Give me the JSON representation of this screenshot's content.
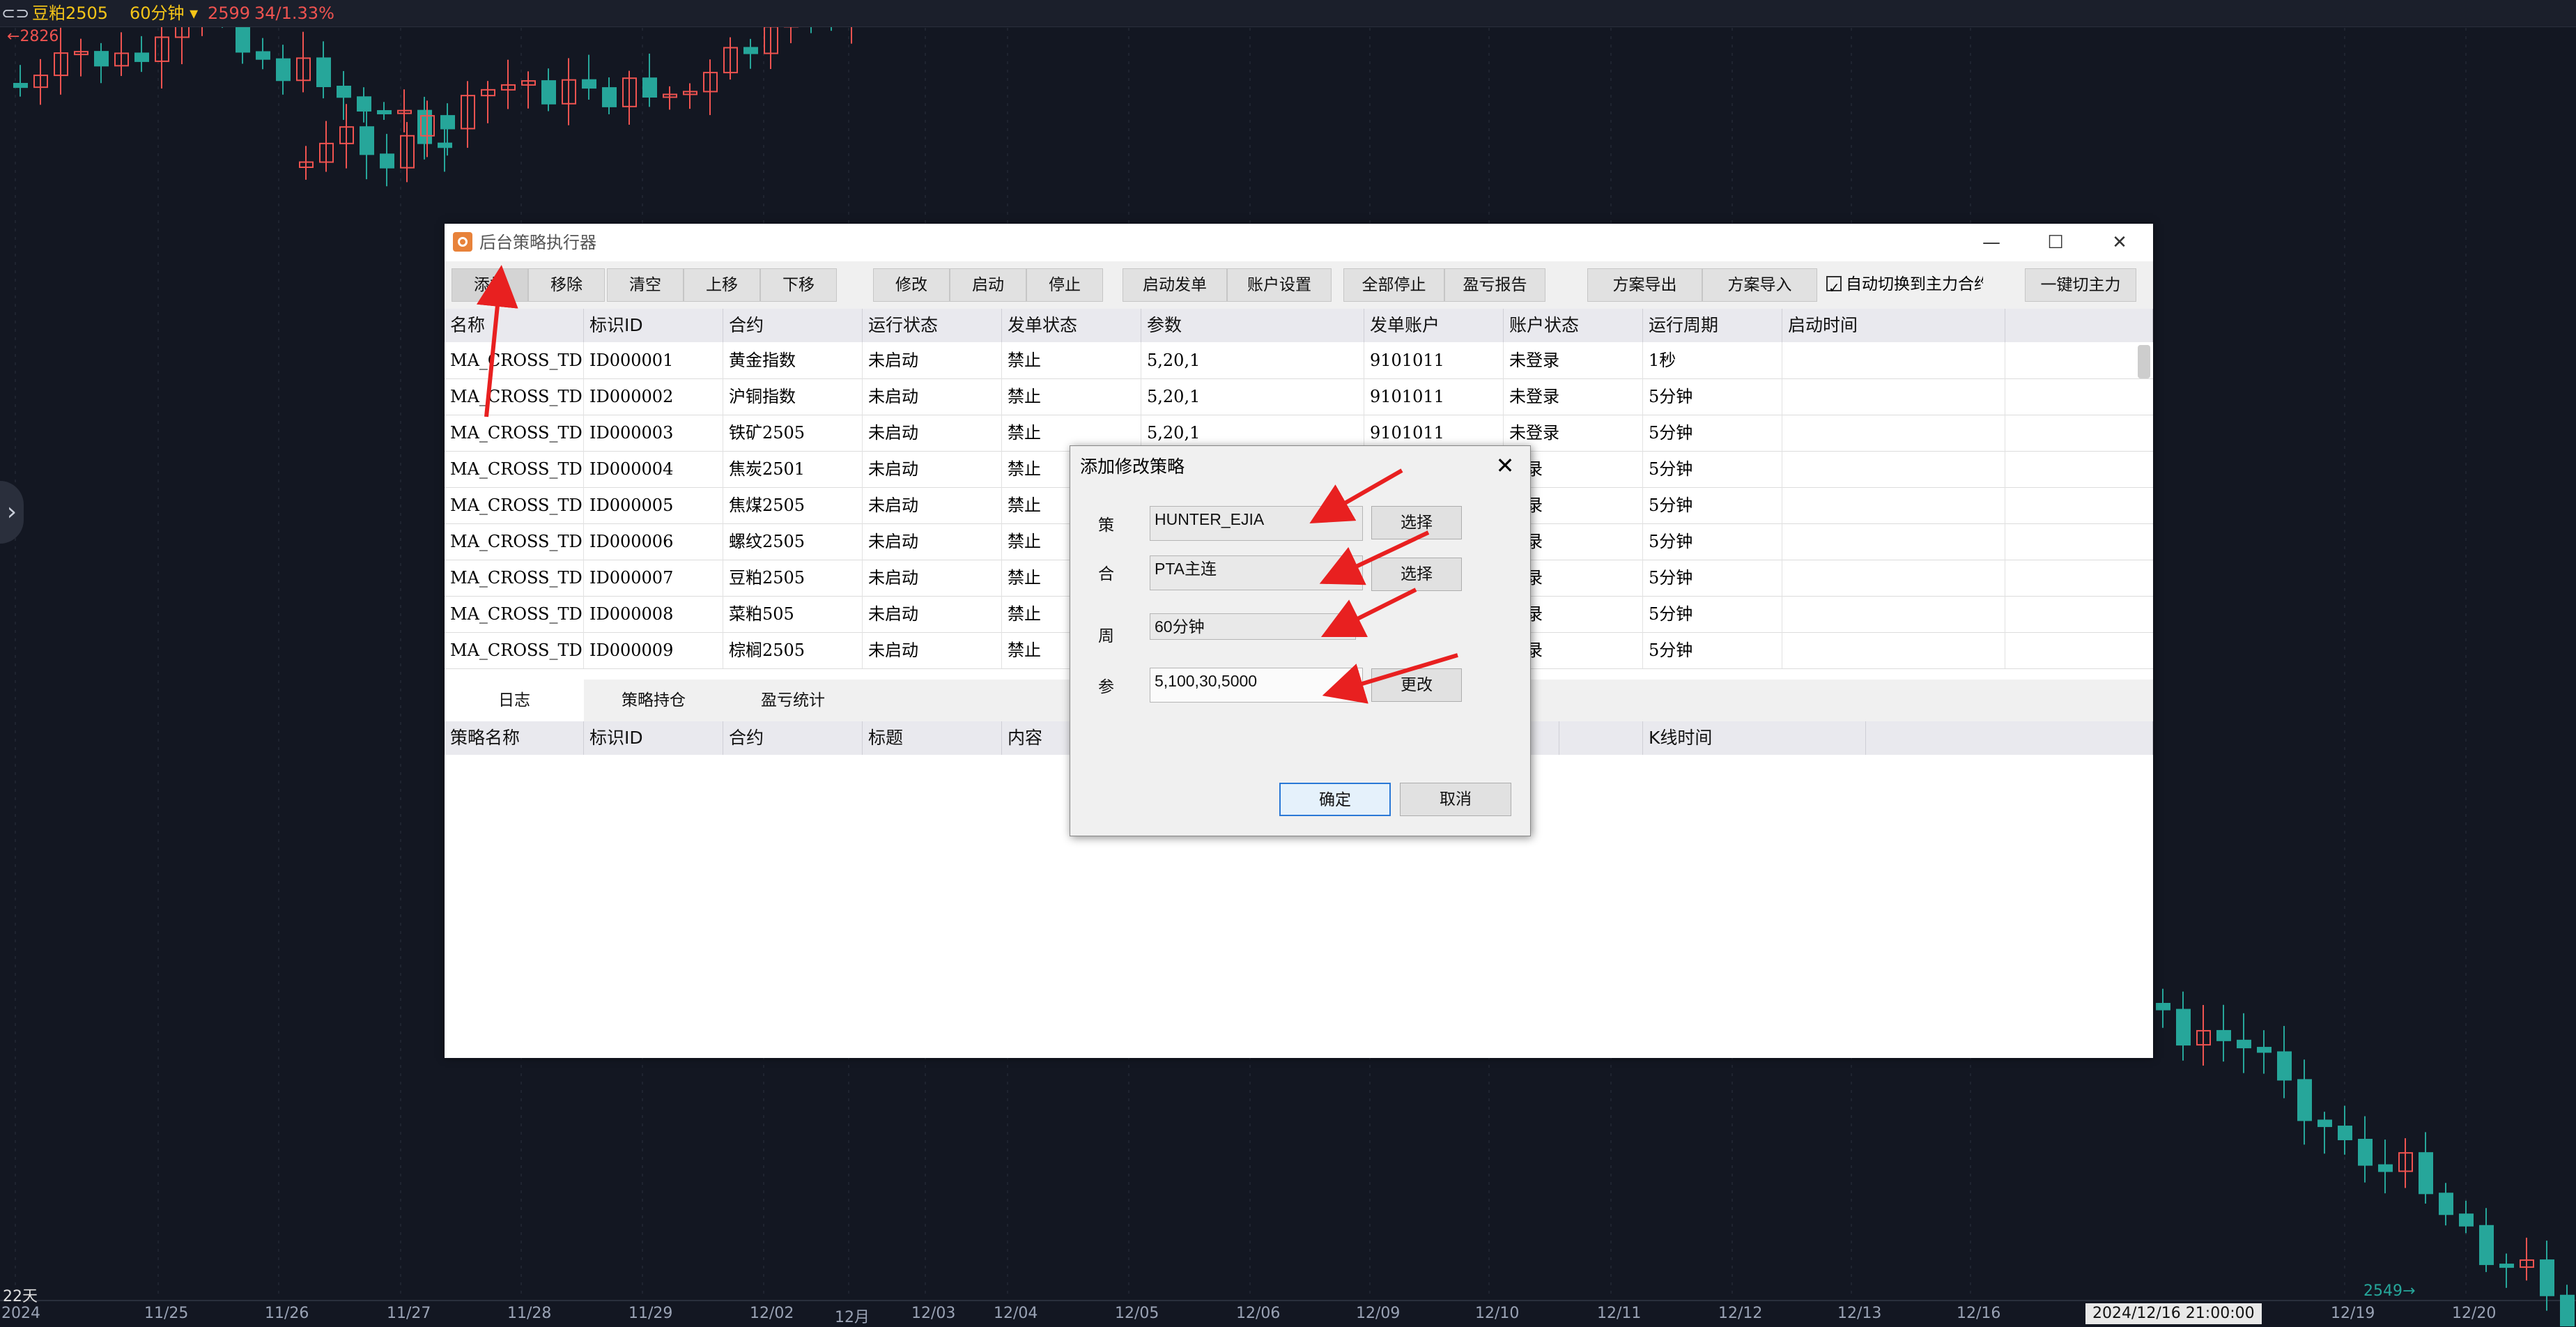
{
  "header": {
    "symbol": "豆粕2505",
    "period": "60分钟",
    "price": "2599",
    "change": "34/1.33%"
  },
  "chart": {
    "high_price_label": "2826",
    "low_price_label": "2549",
    "bar_count_label": "22天",
    "crosshair_time": "2024/12/16 21:00:00",
    "x_axis_labels": [
      "2024",
      "11/25",
      "11/26",
      "11/27",
      "11/28",
      "11/29",
      "12/02",
      "12月",
      "12/03",
      "12/04",
      "12/05",
      "12/06",
      "12/09",
      "12/10",
      "12/11",
      "12/12",
      "12/13",
      "12/16",
      "12/19",
      "12/20"
    ],
    "colors": {
      "up": "#ef5350",
      "down": "#26a69a",
      "background": "#131722"
    }
  },
  "window": {
    "title": "后台策略执行器",
    "controls": [
      "—",
      "☐",
      "✕"
    ]
  },
  "toolbar": {
    "add": "添加",
    "remove": "移除",
    "clear": "清空",
    "move_up": "上移",
    "move_down": "下移",
    "modify": "修改",
    "start": "启动",
    "stop": "停止",
    "start_order": "启动发单",
    "account_settings": "账户设置",
    "stop_all": "全部停止",
    "pnl_report": "盈亏报告",
    "export_plan": "方案导出",
    "import_plan": "方案导入",
    "auto_switch": "自动切换到主力合约",
    "switch_main": "一键切主力"
  },
  "strategy_table": {
    "columns": [
      "名称",
      "标识ID",
      "合约",
      "运行状态",
      "发单状态",
      "参数",
      "发单账户",
      "账户状态",
      "运行周期",
      "启动时间",
      ""
    ],
    "rows": [
      [
        "MA_CROSS_TD",
        "ID000001",
        "黄金指数",
        "未启动",
        "禁止",
        "5,20,1",
        "9101011",
        "未登录",
        "1秒",
        ""
      ],
      [
        "MA_CROSS_TD",
        "ID000002",
        "沪铜指数",
        "未启动",
        "禁止",
        "5,20,1",
        "9101011",
        "未登录",
        "5分钟",
        ""
      ],
      [
        "MA_CROSS_TD",
        "ID000003",
        "铁矿2505",
        "未启动",
        "禁止",
        "5,20,1",
        "9101011",
        "未登录",
        "5分钟",
        ""
      ],
      [
        "MA_CROSS_TD",
        "ID000004",
        "焦炭2501",
        "未启动",
        "禁止",
        "",
        "",
        "登录",
        "5分钟",
        ""
      ],
      [
        "MA_CROSS_TD",
        "ID000005",
        "焦煤2505",
        "未启动",
        "禁止",
        "",
        "",
        "登录",
        "5分钟",
        ""
      ],
      [
        "MA_CROSS_TD",
        "ID000006",
        "螺纹2505",
        "未启动",
        "禁止",
        "",
        "",
        "登录",
        "5分钟",
        ""
      ],
      [
        "MA_CROSS_TD",
        "ID000007",
        "豆粕2505",
        "未启动",
        "禁止",
        "",
        "",
        "登录",
        "5分钟",
        ""
      ],
      [
        "MA_CROSS_TD",
        "ID000008",
        "菜粕505",
        "未启动",
        "禁止",
        "",
        "",
        "登录",
        "5分钟",
        ""
      ],
      [
        "MA_CROSS_TD",
        "ID000009",
        "棕榈2505",
        "未启动",
        "禁止",
        "",
        "",
        "登录",
        "5分钟",
        ""
      ]
    ]
  },
  "tabs": [
    "日志",
    "策略持仓",
    "盈亏统计"
  ],
  "log_table": {
    "columns": [
      "策略名称",
      "标识ID",
      "合约",
      "标题",
      "内容",
      "",
      "",
      "",
      "",
      "K线时间",
      ""
    ]
  },
  "dialog": {
    "title": "添加修改策略",
    "close": "✕",
    "strategy_label": "策",
    "strategy_value": "HUNTER_EJIA",
    "contract_label": "合",
    "contract_value": "PTA主连",
    "period_label": "周",
    "period_value": "60分钟",
    "param_label": "参",
    "param_value": "5,100,30,5000",
    "select1": "选择",
    "select2": "选择",
    "change": "更改",
    "ok": "确定",
    "cancel": "取消"
  }
}
